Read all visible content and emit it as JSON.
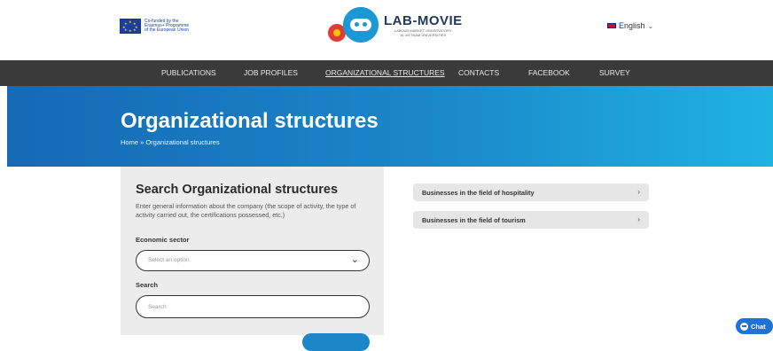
{
  "header": {
    "eu_text_lines": [
      "Co-funded by the",
      "Erasmus+ Programme",
      "of the European Union"
    ],
    "brand_title": "LAB-MOVIE",
    "brand_subtitle_lines": [
      "LABOUR MARKET OBSERVATORY",
      "IN VIETNAM UNIVERSITIES"
    ],
    "language": "English"
  },
  "nav": {
    "items": [
      {
        "label": "PUBLICATIONS",
        "active": false
      },
      {
        "label": "JOB PROFILES",
        "active": false
      },
      {
        "label": "ORGANIZATIONAL STRUCTURES",
        "active": true
      },
      {
        "label": "CONTACTS",
        "active": false
      },
      {
        "label": "FACEBOOK",
        "active": false
      },
      {
        "label": "SURVEY",
        "active": false
      }
    ]
  },
  "hero": {
    "title": "Organizational structures",
    "breadcrumb": "Home » Organizational structures"
  },
  "search": {
    "title": "Search Organizational structures",
    "description": "Enter general information about the company (the scope of activity, the type of activity carried out, the certifications possessed, etc.)",
    "sector_label": "Economic sector",
    "sector_placeholder": "Select an option",
    "search_label": "Search",
    "search_placeholder": "Search"
  },
  "results": {
    "items": [
      {
        "label": "Businesses in the field of hospitality"
      },
      {
        "label": "Businesses in the field of tourism"
      }
    ]
  },
  "chat": {
    "label": "Chat"
  },
  "colors": {
    "nav_bg": "#3a3a3a",
    "hero_start": "#1669b4",
    "hero_end": "#1fb3e2",
    "panel_bg": "#ececec",
    "accent": "#1b87c9"
  }
}
